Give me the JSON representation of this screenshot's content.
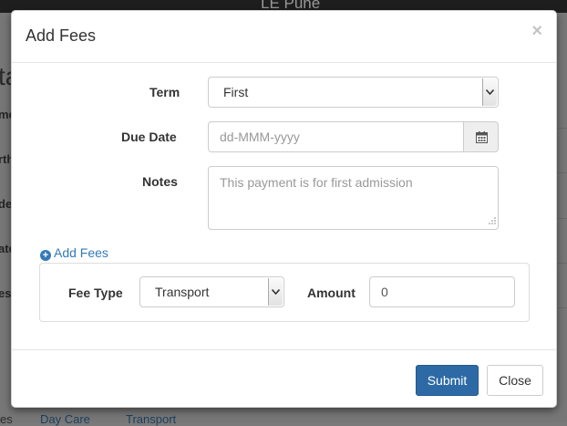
{
  "background": {
    "topbar_title": "LE Pune",
    "left_fragments": [
      "ta",
      "me",
      "rth",
      "de",
      "ate",
      "es"
    ],
    "footer_links": [
      "Day Care",
      "Transport"
    ],
    "footer_left": "es"
  },
  "modal": {
    "title": "Add Fees",
    "close_glyph": "×",
    "term": {
      "label": "Term",
      "value": "First"
    },
    "due_date": {
      "label": "Due Date",
      "placeholder": "dd-MMM-yyyy"
    },
    "notes": {
      "label": "Notes",
      "placeholder": "This payment is for first admission"
    },
    "add_fees_link": "Add Fees",
    "fee_row": {
      "fee_type_label": "Fee Type",
      "fee_type_value": "Transport",
      "amount_label": "Amount",
      "amount_value": "0"
    },
    "buttons": {
      "submit": "Submit",
      "close": "Close"
    }
  },
  "colors": {
    "primary": "#2d6aa5",
    "link": "#337ab7",
    "overlay": "#777777"
  },
  "icons": [
    "close-icon",
    "calendar-icon",
    "plus-circle-icon",
    "chevron-down-icon",
    "resize-grip-icon"
  ]
}
